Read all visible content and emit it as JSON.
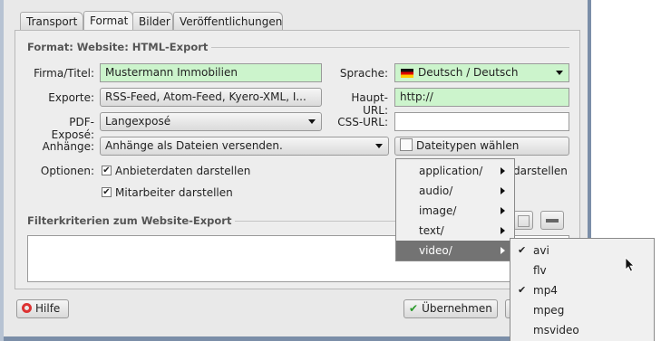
{
  "tabs": [
    "Transport",
    "Format",
    "Bilder",
    "Veröffentlichungen"
  ],
  "section": {
    "format_title": "Format: Website: HTML-Export",
    "filter_title": "Filterkriterien zum Website-Export"
  },
  "form": {
    "firma_label": "Firma/Titel:",
    "firma_value": "Mustermann Immobilien",
    "sprache_label": "Sprache:",
    "sprache_value": "Deutsch / Deutsch",
    "exporte_label": "Exporte:",
    "exporte_value": "RSS-Feed, Atom-Feed, Kyero-XML, I...",
    "haupturl_label": "Haupt-URL:",
    "haupturl_value": "http://",
    "pdf_label": "PDF-Exposé:",
    "pdf_value": "Langexposé",
    "cssurl_label": "CSS-URL:",
    "cssurl_value": "",
    "anhaenge_label": "Anhänge:",
    "anhaenge_value": "Anhänge als Dateien versenden.",
    "dateitypen_button": "Dateitypen wählen",
    "optionen_label": "Optionen:",
    "opt1": "Anbieterdaten darstellen",
    "opt2": "Mitarbeiter darstellen",
    "opt3_partial": "darstellen"
  },
  "buttons": {
    "help": "Hilfe",
    "apply": "Übernehmen"
  },
  "menu": {
    "items": [
      "application/",
      "audio/",
      "image/",
      "text/",
      "video/"
    ],
    "selected": "video/"
  },
  "submenu": {
    "items": [
      {
        "label": "avi",
        "checked": true
      },
      {
        "label": "flv",
        "checked": false
      },
      {
        "label": "mp4",
        "checked": true
      },
      {
        "label": "mpeg",
        "checked": false
      },
      {
        "label": "msvideo",
        "checked": false
      }
    ]
  }
}
